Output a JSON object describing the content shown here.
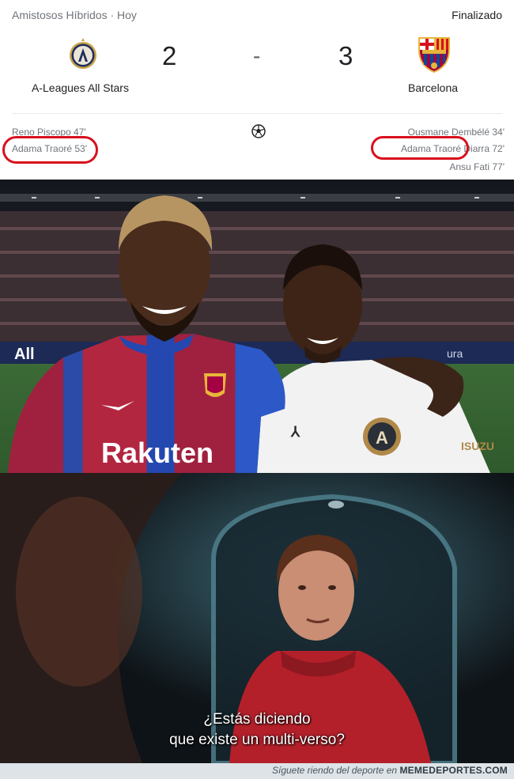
{
  "match": {
    "competition": "Amistosos Híbridos · Hoy",
    "status": "Finalizado",
    "home": {
      "name": "A-Leagues All Stars",
      "score": "2",
      "crest_icon": "a-leagues-crest-icon"
    },
    "away": {
      "name": "Barcelona",
      "score": "3",
      "crest_icon": "barcelona-crest-icon"
    },
    "separator": "-",
    "home_scorers": [
      "Reno Piscopo 47'",
      "Adama Traoré 53'"
    ],
    "away_scorers": [
      "Ousmane Dembélé 34'",
      "Adama Traoré Diarra 72'",
      "Ansu Fati 77'"
    ],
    "highlight_color": "#d8101c"
  },
  "photo": {
    "home_kit_sponsor": "Rakuten",
    "away_kit_sponsor": "ISUZU"
  },
  "movie": {
    "subtitle_line1": "¿Estás diciendo",
    "subtitle_line2": "que existe un multi-verso?"
  },
  "footer": {
    "text": "Síguete riendo del deporte en",
    "brand": "MEMEDEPORTES.COM"
  }
}
